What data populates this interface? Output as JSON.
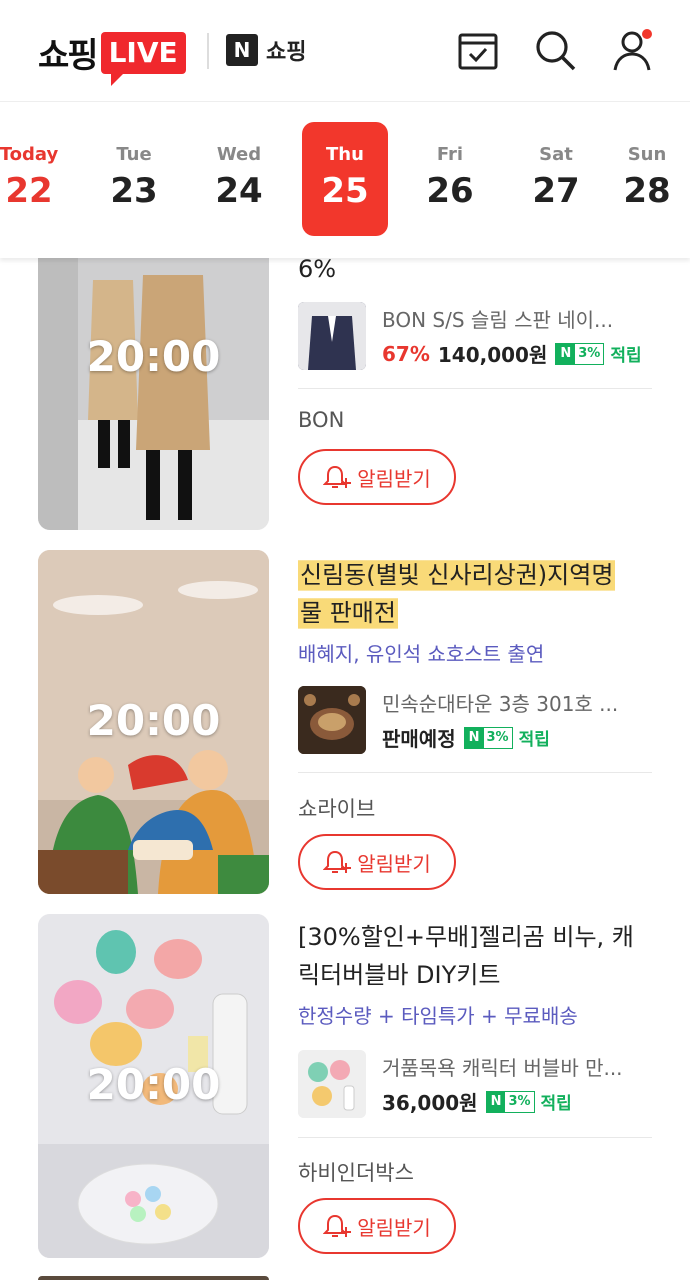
{
  "header": {
    "logo_text": "쇼핑",
    "logo_live": "LIVE",
    "nshop_badge": "N",
    "nshop_label": "쇼핑",
    "icons": [
      "calendar-check-icon",
      "search-icon",
      "user-icon"
    ]
  },
  "dates": [
    {
      "dow": "Today",
      "day": "22"
    },
    {
      "dow": "Tue",
      "day": "23"
    },
    {
      "dow": "Wed",
      "day": "24"
    },
    {
      "dow": "Thu",
      "day": "25"
    },
    {
      "dow": "Fri",
      "day": "26"
    },
    {
      "dow": "Sat",
      "day": "27"
    },
    {
      "dow": "Sun",
      "day": "28"
    }
  ],
  "items": [
    {
      "time": "20:00",
      "title_tail": "6%",
      "product": {
        "name": "BON S/S 슬림 스판 네이...",
        "discount": "67%",
        "price": "140,000원",
        "npay_n": "N",
        "npay_pct": "3%",
        "npay_earn": "적립"
      },
      "brand": "BON",
      "alarm": "알림받기"
    },
    {
      "time": "20:00",
      "title_line1": "신림동(별빛 신사리상권)지역명",
      "title_line2": "물 판매전",
      "subtitle": "배혜지, 유인석 쇼호스트 출연",
      "product": {
        "name": "민속순대타운 3층 301호 ...",
        "status": "판매예정",
        "npay_n": "N",
        "npay_pct": "3%",
        "npay_earn": "적립"
      },
      "brand": "쇼라이브",
      "alarm": "알림받기"
    },
    {
      "time": "20:00",
      "title_line1": "[30%할인+무배]젤리곰 비누, 캐",
      "title_line2": "릭터버블바 DIY키트",
      "subtitle": "한정수량 + 타임특가 + 무료배송",
      "product": {
        "name": "거품목욕 캐릭터 버블바 만...",
        "price": "36,000원",
        "npay_n": "N",
        "npay_pct": "3%",
        "npay_earn": "적립"
      },
      "brand": "하비인더박스",
      "alarm": "알림받기"
    }
  ],
  "colors": {
    "accent": "#f2372c",
    "npay_green": "#12b05c",
    "subtitle_purple": "#5b5bbf"
  }
}
